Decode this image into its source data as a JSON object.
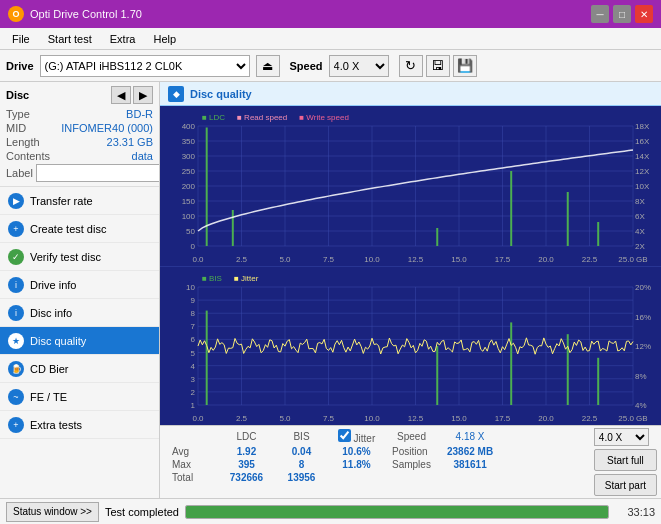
{
  "titleBar": {
    "title": "Opti Drive Control 1.70",
    "minBtn": "─",
    "maxBtn": "□",
    "closeBtn": "✕"
  },
  "menuBar": {
    "items": [
      "File",
      "Start test",
      "Extra",
      "Help"
    ]
  },
  "driveBar": {
    "label": "Drive",
    "driveValue": "(G:) ATAPI iHBS112  2 CL0K",
    "ejectIcon": "⏏",
    "speedLabel": "Speed",
    "speedValue": "4.0 X"
  },
  "disc": {
    "title": "Disc",
    "typeLabel": "Type",
    "typeValue": "BD-R",
    "midLabel": "MID",
    "midValue": "INFOMER40 (000)",
    "lengthLabel": "Length",
    "lengthValue": "23.31 GB",
    "contentsLabel": "Contents",
    "contentsValue": "data",
    "labelLabel": "Label",
    "labelValue": ""
  },
  "navItems": [
    {
      "id": "transfer-rate",
      "label": "Transfer rate",
      "active": false
    },
    {
      "id": "create-test-disc",
      "label": "Create test disc",
      "active": false
    },
    {
      "id": "verify-test-disc",
      "label": "Verify test disc",
      "active": false
    },
    {
      "id": "drive-info",
      "label": "Drive info",
      "active": false
    },
    {
      "id": "disc-info",
      "label": "Disc info",
      "active": false
    },
    {
      "id": "disc-quality",
      "label": "Disc quality",
      "active": true
    },
    {
      "id": "cd-bier",
      "label": "CD Bier",
      "active": false
    },
    {
      "id": "fe-te",
      "label": "FE / TE",
      "active": false
    },
    {
      "id": "extra-tests",
      "label": "Extra tests",
      "active": false
    }
  ],
  "discQuality": {
    "title": "Disc quality"
  },
  "chart1": {
    "legend": [
      "LDC",
      "Read speed",
      "Write speed"
    ],
    "yAxisLeft": [
      400,
      350,
      300,
      250,
      200,
      150,
      100,
      50,
      0
    ],
    "yAxisRight": [
      "18X",
      "16X",
      "14X",
      "12X",
      "10X",
      "8X",
      "6X",
      "4X",
      "2X"
    ],
    "xAxisLabels": [
      "0.0",
      "2.5",
      "5.0",
      "7.5",
      "10.0",
      "12.5",
      "15.0",
      "17.5",
      "20.0",
      "22.5",
      "25.0 GB"
    ]
  },
  "chart2": {
    "legend": [
      "BIS",
      "Jitter"
    ],
    "yAxisLeft": [
      "10",
      "9",
      "8",
      "7",
      "6",
      "5",
      "4",
      "3",
      "2",
      "1"
    ],
    "yAxisRight": [
      "20%",
      "16%",
      "12%",
      "8%",
      "4%"
    ],
    "xAxisLabels": [
      "0.0",
      "2.5",
      "5.0",
      "7.5",
      "10.0",
      "12.5",
      "15.0",
      "17.5",
      "20.0",
      "22.5",
      "25.0 GB"
    ]
  },
  "stats": {
    "columns": [
      "LDC",
      "BIS",
      "",
      "Jitter",
      "Speed",
      "4.18 X"
    ],
    "jitterChecked": true,
    "rows": [
      {
        "label": "Avg",
        "ldc": "1.92",
        "bis": "0.04",
        "jitter": "10.6%"
      },
      {
        "label": "Max",
        "ldc": "395",
        "bis": "8",
        "jitter": "11.8%"
      },
      {
        "label": "Total",
        "ldc": "732666",
        "bis": "13956",
        "jitter": ""
      }
    ],
    "speedLabel": "Speed",
    "speedValue": "4.18 X",
    "speedSelectValue": "4.0 X",
    "positionLabel": "Position",
    "positionValue": "23862 MB",
    "samplesLabel": "Samples",
    "samplesValue": "381611",
    "startFullBtn": "Start full",
    "startPartBtn": "Start part"
  },
  "statusBar": {
    "statusWindowBtn": "Status window >>",
    "statusText": "Test completed",
    "progress": 100,
    "time": "33:13"
  }
}
